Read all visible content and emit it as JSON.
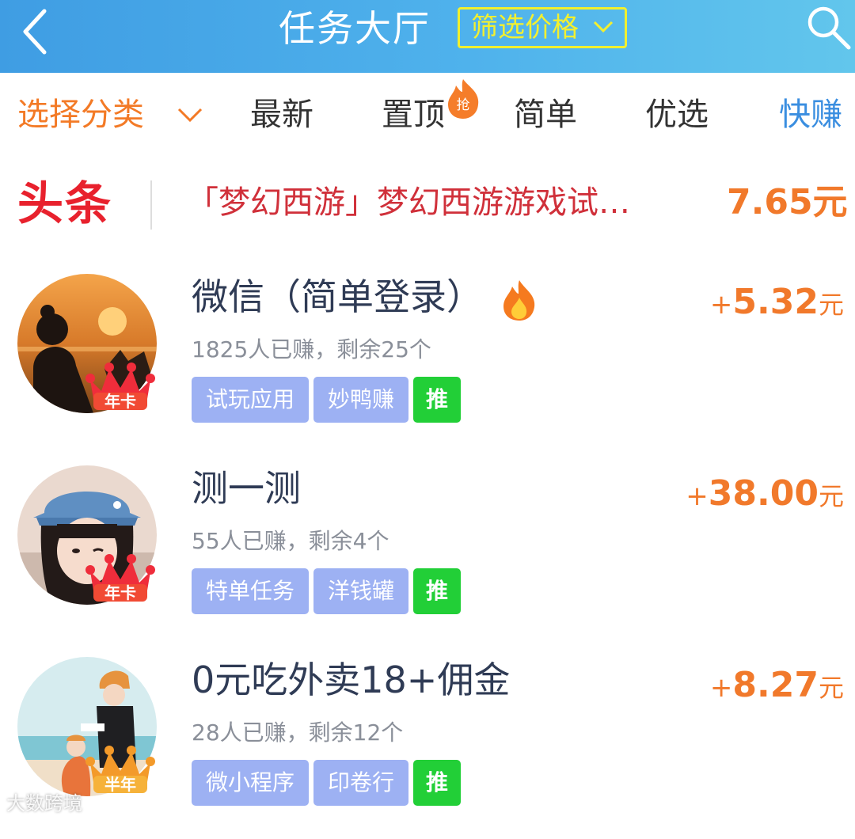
{
  "header": {
    "title": "任务大厅",
    "filter_label": "筛选价格",
    "colors": {
      "start": "#3f9de3",
      "end": "#62c6ec",
      "filter": "#f3f02f"
    }
  },
  "tabs": [
    {
      "label": "选择分类"
    },
    {
      "label": "最新"
    },
    {
      "label": "置顶",
      "badge": "抢"
    },
    {
      "label": "简单"
    },
    {
      "label": "优选"
    },
    {
      "label": "快赚",
      "active": true
    }
  ],
  "headline": {
    "logo": "头条",
    "text": "「梦幻西游」梦幻西游游戏试…",
    "price": "7.65元"
  },
  "tasks": [
    {
      "title": "微信（简单登录）",
      "hot": true,
      "stats": "1825人已赚，剩余25个",
      "tags": [
        "试玩应用",
        "妙鸭赚",
        "推"
      ],
      "reward_plus": "+",
      "reward_amount": "5.32",
      "reward_unit": "元",
      "crown_label": "年卡"
    },
    {
      "title": "测一测",
      "hot": false,
      "stats": "55人已赚，剩余4个",
      "tags": [
        "特单任务",
        "洋钱罐",
        "推"
      ],
      "reward_plus": "+",
      "reward_amount": "38.00",
      "reward_unit": "元",
      "crown_label": "年卡"
    },
    {
      "title": "0元吃外卖18+佣金",
      "hot": false,
      "stats": "28人已赚，剩余12个",
      "tags": [
        "微小程序",
        "印卷行",
        "推"
      ],
      "reward_plus": "+",
      "reward_amount": "8.27",
      "reward_unit": "元",
      "crown_label": "半年"
    }
  ],
  "watermark": "大数跨境",
  "icons": [
    "back-arrow-icon",
    "chevron-down-icon",
    "search-icon",
    "flame-icon",
    "crown-icon"
  ]
}
